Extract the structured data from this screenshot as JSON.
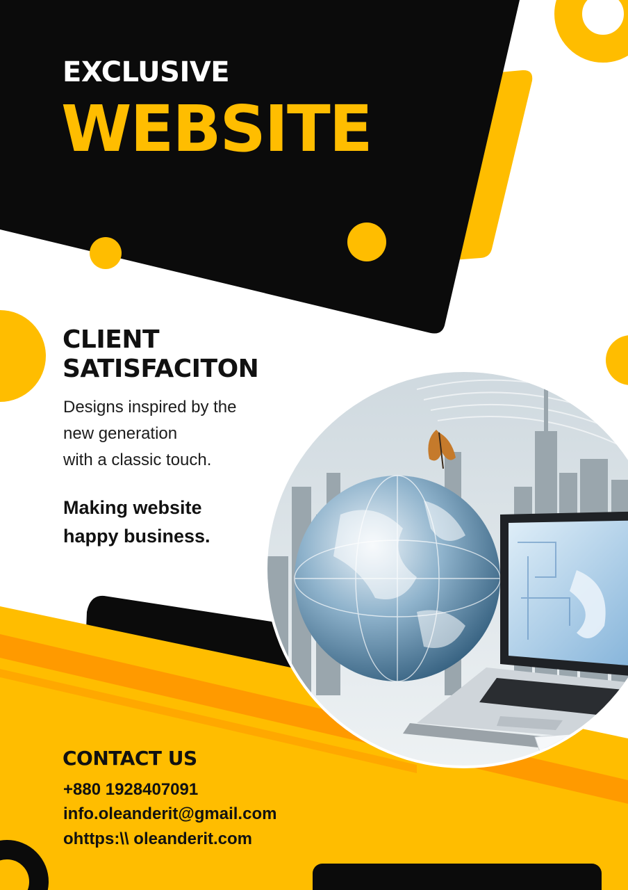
{
  "header": {
    "kicker": "EXCLUSIVE",
    "title": "WEBSITE"
  },
  "feature": {
    "heading_line1": "CLIENT",
    "heading_line2": "SATISFACITON",
    "description": [
      "Designs inspired by the",
      "new generation",
      "with a classic touch."
    ],
    "tagline": [
      "Making website",
      "happy business."
    ]
  },
  "contact": {
    "heading": "CONTACT US",
    "phone": "+880 1928407091",
    "email": "info.oleanderit@gmail.com",
    "website": "ohttps:\\\\ oleanderit.com"
  },
  "illustration": {
    "subject": "globe-laptop-city-illustration"
  },
  "colors": {
    "accent": "#ffbd00",
    "accent_dark": "#ff9a00",
    "dark": "#0b0b0b",
    "background": "#ffffff"
  }
}
